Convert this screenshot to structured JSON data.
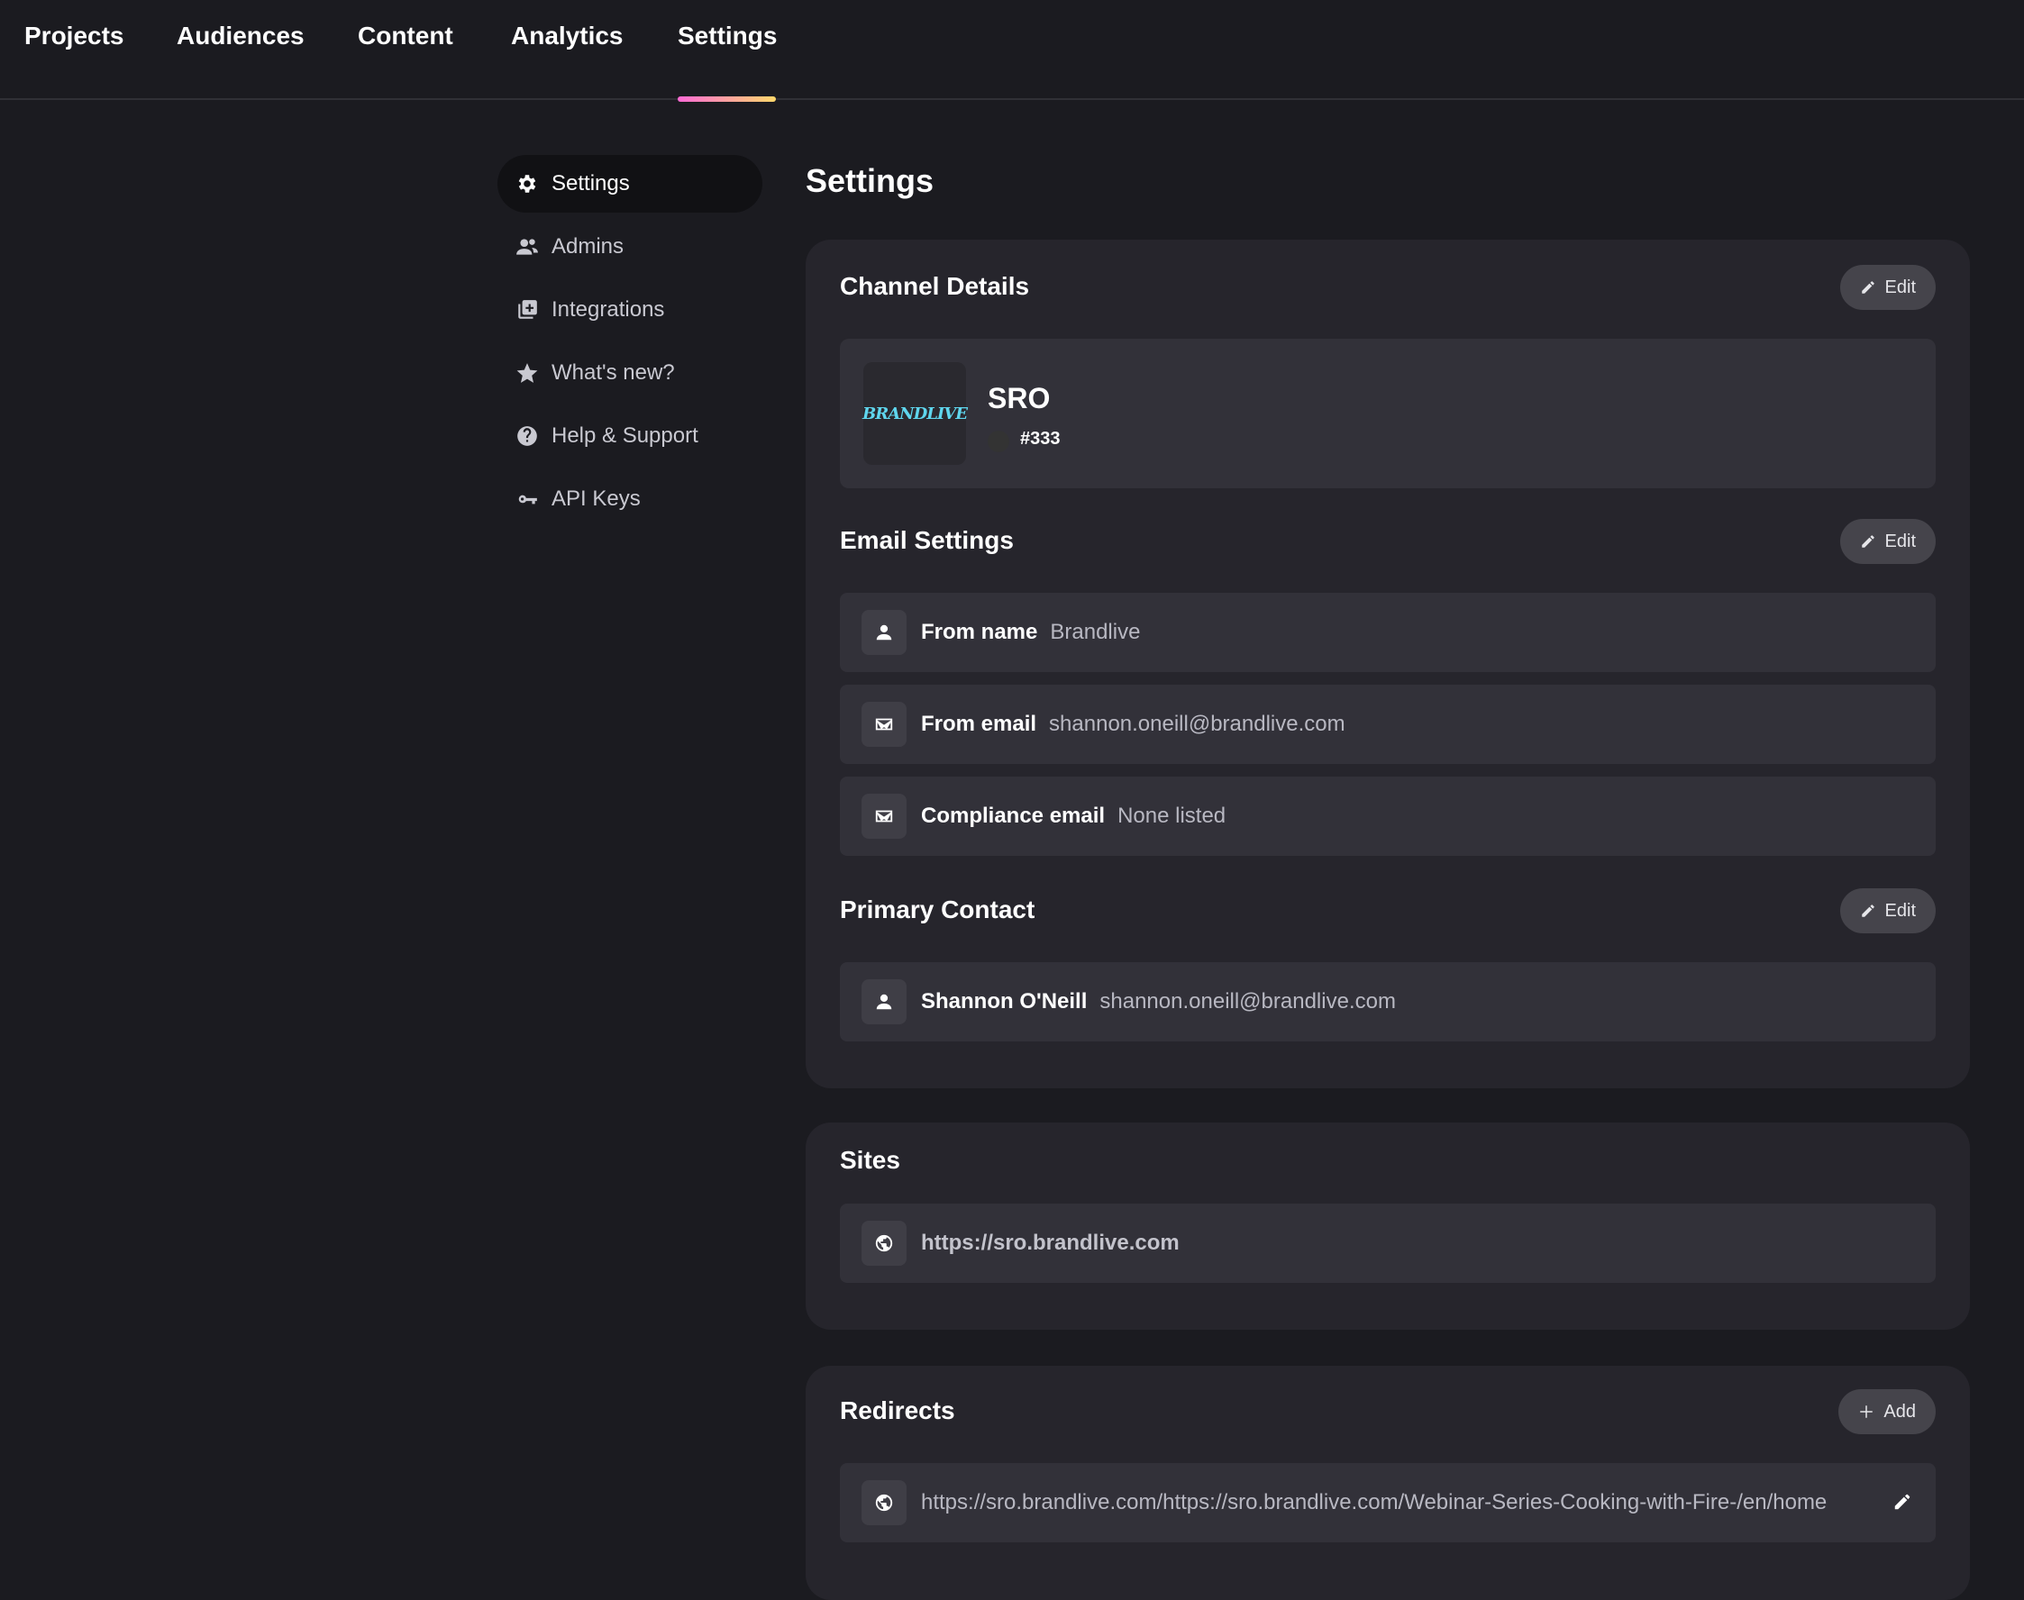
{
  "topnav": {
    "tabs": [
      {
        "label": "Projects"
      },
      {
        "label": "Audiences"
      },
      {
        "label": "Content"
      },
      {
        "label": "Analytics"
      },
      {
        "label": "Settings"
      }
    ],
    "active_tab": "Settings",
    "accent_gradient": [
      "#ff6ad5",
      "#ffd86b"
    ]
  },
  "sidebar": {
    "items": [
      {
        "label": "Settings",
        "icon": "gear-icon"
      },
      {
        "label": "Admins",
        "icon": "users-icon"
      },
      {
        "label": "Integrations",
        "icon": "integrations-icon"
      },
      {
        "label": "What's new?",
        "icon": "star-icon"
      },
      {
        "label": "Help & Support",
        "icon": "help-icon"
      },
      {
        "label": "API Keys",
        "icon": "key-icon"
      }
    ],
    "active_item": "Settings"
  },
  "main": {
    "title": "Settings",
    "channel": {
      "section_title": "Channel Details",
      "edit_label": "Edit",
      "logo_text": "BRANDLIVE",
      "name": "SRO",
      "color": "#333"
    },
    "email": {
      "section_title": "Email Settings",
      "edit_label": "Edit",
      "rows": [
        {
          "label": "From name",
          "value": "Brandlive",
          "icon": "person-icon"
        },
        {
          "label": "From email",
          "value": "shannon.oneill@brandlive.com",
          "icon": "mail-icon"
        },
        {
          "label": "Compliance email",
          "value": "None listed",
          "icon": "mail-icon"
        }
      ]
    },
    "contact": {
      "section_title": "Primary Contact",
      "edit_label": "Edit",
      "name": "Shannon O'Neill",
      "email": "shannon.oneill@brandlive.com"
    },
    "sites": {
      "section_title": "Sites",
      "url": "https://sro.brandlive.com"
    },
    "redirects": {
      "section_title": "Redirects",
      "add_label": "Add",
      "items": [
        {
          "url": "https://sro.brandlive.com/https://sro.brandlive.com/Webinar-Series-Cooking-with-Fire-/en/home"
        }
      ]
    }
  }
}
